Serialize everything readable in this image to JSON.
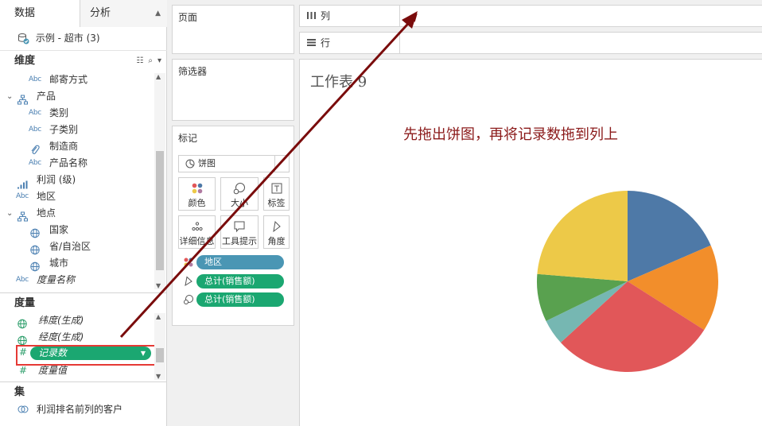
{
  "tabs": {
    "data": "数据",
    "analysis": "分析"
  },
  "datasource": {
    "name": "示例 - 超市 (3)"
  },
  "dimensions": {
    "header": "维度",
    "items": [
      {
        "label": "邮寄方式",
        "icon": "abc-icon",
        "icon_text": "Abc"
      },
      {
        "label": "产品",
        "icon": "hierarchy-icon",
        "expanded": true
      },
      {
        "label": "类别",
        "icon": "abc-icon",
        "icon_text": "Abc"
      },
      {
        "label": "子类别",
        "icon": "abc-icon",
        "icon_text": "Abc"
      },
      {
        "label": "制造商",
        "icon": "paperclip-icon"
      },
      {
        "label": "产品名称",
        "icon": "abc-icon",
        "icon_text": "Abc"
      },
      {
        "label": "利润 (级)",
        "icon": "bin-bars-icon"
      },
      {
        "label": "地区",
        "icon": "abc-icon",
        "icon_text": "Abc"
      },
      {
        "label": "地点",
        "icon": "hierarchy-icon",
        "expanded": true
      },
      {
        "label": "国家",
        "icon": "globe-icon"
      },
      {
        "label": "省/自治区",
        "icon": "globe-icon"
      },
      {
        "label": "城市",
        "icon": "globe-icon"
      },
      {
        "label": "度量名称",
        "icon": "abc-icon",
        "icon_text": "Abc"
      }
    ]
  },
  "measures": {
    "header": "度量",
    "items": [
      {
        "label": "纬度(生成)",
        "icon": "globe-icon"
      },
      {
        "label": "经度(生成)",
        "icon": "globe-icon"
      },
      {
        "label": "记录数",
        "icon": "hash-icon",
        "selected": true
      },
      {
        "label": "度量值",
        "icon": "hash-icon"
      }
    ]
  },
  "sets": {
    "header": "集",
    "items": [
      {
        "label": "利润排名前列的客户",
        "icon": "set-icon"
      }
    ]
  },
  "cards": {
    "pages": "页面",
    "filters": "筛选器",
    "marks": "标记"
  },
  "marks": {
    "type": "饼图",
    "buttons": [
      {
        "label": "颜色",
        "icon": "color-icon"
      },
      {
        "label": "大小",
        "icon": "size-icon"
      },
      {
        "label": "标签",
        "icon": "label-icon"
      },
      {
        "label": "详细信息",
        "icon": "detail-icon"
      },
      {
        "label": "工具提示",
        "icon": "tooltip-icon"
      },
      {
        "label": "角度",
        "icon": "angle-icon"
      }
    ],
    "pills": [
      {
        "label": "地区",
        "icon": "color-icon",
        "color": "#4a96b4"
      },
      {
        "label": "总计(销售额)",
        "icon": "angle-icon",
        "color": "#1ba771"
      },
      {
        "label": "总计(销售额)",
        "icon": "size-icon",
        "color": "#1ba771"
      }
    ]
  },
  "shelves": {
    "columns": "列",
    "rows": "行"
  },
  "sheet": {
    "title": "工作表 9",
    "annotation": "先拖出饼图，再将记录数拖到列上"
  },
  "chart_data": {
    "type": "pie",
    "title": "",
    "slices": [
      {
        "value": 0.185,
        "color": "#4e79a7"
      },
      {
        "value": 0.155,
        "color": "#f28e2b"
      },
      {
        "value": 0.292,
        "color": "#e15759"
      },
      {
        "value": 0.046,
        "color": "#76b7b2"
      },
      {
        "value": 0.085,
        "color": "#59a14f"
      },
      {
        "value": 0.237,
        "color": "#edc948"
      }
    ]
  },
  "colors": {
    "annotation": "#8b1a1a",
    "highlight": "#e53935",
    "measure_pill": "#1ba771",
    "dimension_pill": "#4a96b4"
  }
}
